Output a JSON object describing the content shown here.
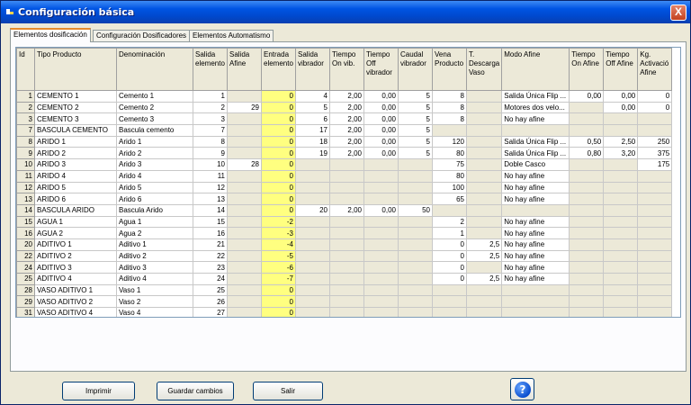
{
  "window": {
    "title": "Configuración básica",
    "close_label": "X"
  },
  "tabs": [
    {
      "label": "Elementos dosificación",
      "active": true
    },
    {
      "label": "Configuración Dosificadores",
      "active": false
    },
    {
      "label": "Elementos Automatismo",
      "active": false
    }
  ],
  "table": {
    "headers": [
      "Id",
      "Tipo Producto",
      "Denominación",
      "Salida elemento",
      "Salida Afine",
      "Entrada elemento",
      "Salida vibrador",
      "Tiempo On vib.",
      "Tiempo Off vibrador",
      "Caudal vibrador",
      "Vena Producto",
      "T. Descarga Vaso",
      "Modo Afine",
      "Tiempo On Afine",
      "Tiempo Off Afine",
      "Kg. Activació Afine"
    ],
    "rows": [
      [
        "1",
        "CEMENTO 1",
        "Cemento 1",
        "1",
        "",
        "0",
        "4",
        "2,00",
        "0,00",
        "5",
        "8",
        "",
        "Salida Única Flip ...",
        "0,00",
        "0,00",
        "0"
      ],
      [
        "2",
        "CEMENTO 2",
        "Cemento 2",
        "2",
        "29",
        "0",
        "5",
        "2,00",
        "0,00",
        "5",
        "8",
        "",
        "Motores dos velo...",
        "",
        "0,00",
        "0"
      ],
      [
        "3",
        "CEMENTO 3",
        "Cemento 3",
        "3",
        "",
        "0",
        "6",
        "2,00",
        "0,00",
        "5",
        "8",
        "",
        "No hay afine",
        "",
        "",
        ""
      ],
      [
        "7",
        "BASCULA CEMENTO",
        "Bascula cemento",
        "7",
        "",
        "0",
        "17",
        "2,00",
        "0,00",
        "5",
        "",
        "",
        "",
        "",
        "",
        ""
      ],
      [
        "8",
        "ARIDO 1",
        "Arido 1",
        "8",
        "",
        "0",
        "18",
        "2,00",
        "0,00",
        "5",
        "120",
        "",
        "Salida Única Flip ...",
        "0,50",
        "2,50",
        "250"
      ],
      [
        "9",
        "ARIDO 2",
        "Arido 2",
        "9",
        "",
        "0",
        "19",
        "2,00",
        "0,00",
        "5",
        "80",
        "",
        "Salida Única Flip ...",
        "0,80",
        "3,20",
        "375"
      ],
      [
        "10",
        "ARIDO 3",
        "Arido 3",
        "10",
        "28",
        "0",
        "",
        "",
        "",
        "",
        "75",
        "",
        "Doble Casco",
        "",
        "",
        "175"
      ],
      [
        "11",
        "ARIDO 4",
        "Arido 4",
        "11",
        "",
        "0",
        "",
        "",
        "",
        "",
        "80",
        "",
        "No hay afine",
        "",
        "",
        ""
      ],
      [
        "12",
        "ARIDO 5",
        "Arido 5",
        "12",
        "",
        "0",
        "",
        "",
        "",
        "",
        "100",
        "",
        "No hay afine",
        "",
        "",
        ""
      ],
      [
        "13",
        "ARIDO 6",
        "Arido 6",
        "13",
        "",
        "0",
        "",
        "",
        "",
        "",
        "65",
        "",
        "No hay afine",
        "",
        "",
        ""
      ],
      [
        "14",
        "BASCULA ARIDO",
        "Bascula Arido",
        "14",
        "",
        "0",
        "20",
        "2,00",
        "0,00",
        "50",
        "",
        "",
        "",
        "",
        "",
        ""
      ],
      [
        "15",
        "AGUA 1",
        "Agua 1",
        "15",
        "",
        "-2",
        "",
        "",
        "",
        "",
        "2",
        "",
        "No hay afine",
        "",
        "",
        ""
      ],
      [
        "16",
        "AGUA 2",
        "Agua 2",
        "16",
        "",
        "-3",
        "",
        "",
        "",
        "",
        "1",
        "",
        "No hay afine",
        "",
        "",
        ""
      ],
      [
        "20",
        "ADITIVO 1",
        "Aditivo 1",
        "21",
        "",
        "-4",
        "",
        "",
        "",
        "",
        "0",
        "2,5",
        "No hay afine",
        "",
        "",
        ""
      ],
      [
        "22",
        "ADITIVO 2",
        "Aditivo 2",
        "22",
        "",
        "-5",
        "",
        "",
        "",
        "",
        "0",
        "2,5",
        "No hay afine",
        "",
        "",
        ""
      ],
      [
        "24",
        "ADITIVO 3",
        "Aditivo 3",
        "23",
        "",
        "-6",
        "",
        "",
        "",
        "",
        "0",
        "",
        "No hay afine",
        "",
        "",
        ""
      ],
      [
        "25",
        "ADITIVO 4",
        "Aditivo 4",
        "24",
        "",
        "-7",
        "",
        "",
        "",
        "",
        "0",
        "2,5",
        "No hay afine",
        "",
        "",
        ""
      ],
      [
        "28",
        "VASO ADITIVO 1",
        "Vaso 1",
        "25",
        "",
        "0",
        "",
        "",
        "",
        "",
        "",
        "",
        "",
        "",
        "",
        ""
      ],
      [
        "29",
        "VASO ADITIVO 2",
        "Vaso 2",
        "26",
        "",
        "0",
        "",
        "",
        "",
        "",
        "",
        "",
        "",
        "",
        "",
        ""
      ],
      [
        "31",
        "VASO ADITIVO 4",
        "Vaso 4",
        "27",
        "",
        "0",
        "",
        "",
        "",
        "",
        "",
        "",
        "",
        "",
        "",
        ""
      ]
    ]
  },
  "buttons": {
    "print": "Imprimir",
    "save": "Guardar cambios",
    "exit": "Salir",
    "help": "?"
  },
  "colors": {
    "highlight": "#ffff80",
    "readonly": "#ece9d8",
    "titlebar": "#0054e3"
  }
}
